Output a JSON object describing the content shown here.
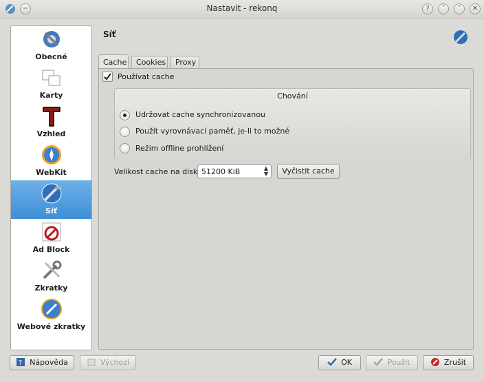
{
  "window": {
    "title": "Nastavit - rekonq"
  },
  "titlebar_buttons": [
    "?",
    "˅",
    "˄",
    "✕"
  ],
  "sidebar": {
    "items": [
      {
        "label": "Obecné",
        "icon": "settings-general-icon"
      },
      {
        "label": "Karty",
        "icon": "tabs-icon"
      },
      {
        "label": "Vzhled",
        "icon": "font-appearance-icon"
      },
      {
        "label": "WebKit",
        "icon": "compass-webkit-icon"
      },
      {
        "label": "Síť",
        "icon": "network-globe-icon",
        "active": true
      },
      {
        "label": "Ad Block",
        "icon": "adblock-icon"
      },
      {
        "label": "Zkratky",
        "icon": "shortcuts-tools-icon"
      },
      {
        "label": "Webové zkratky",
        "icon": "web-shortcuts-globe-icon"
      }
    ]
  },
  "page": {
    "title": "Síť"
  },
  "tabs": [
    {
      "label": "Cache",
      "active": true
    },
    {
      "label": "Cookies"
    },
    {
      "label": "Proxy"
    }
  ],
  "cache": {
    "use_cache_label": "Používat cache",
    "use_cache_checked": true,
    "group_title": "Chování",
    "options": [
      {
        "label": "Udržovat cache synchronizovanou",
        "selected": true
      },
      {
        "label": "Použít vyrovnávací paměť, je-li to možné",
        "selected": false
      },
      {
        "label": "Režim offline prohlížení",
        "selected": false
      }
    ],
    "size_label": "Velikost cache na disku:",
    "size_value": "51200 KiB",
    "clear_label": "Vyčistit cache"
  },
  "footer": {
    "help_label": "Nápověda",
    "defaults_label": "Výchozí",
    "ok_label": "OK",
    "apply_label": "Použít",
    "cancel_label": "Zrušit"
  },
  "colors": {
    "accent": "#3d8fd6",
    "cancel": "#c0282a",
    "ok_check": "#2f6fb3"
  }
}
